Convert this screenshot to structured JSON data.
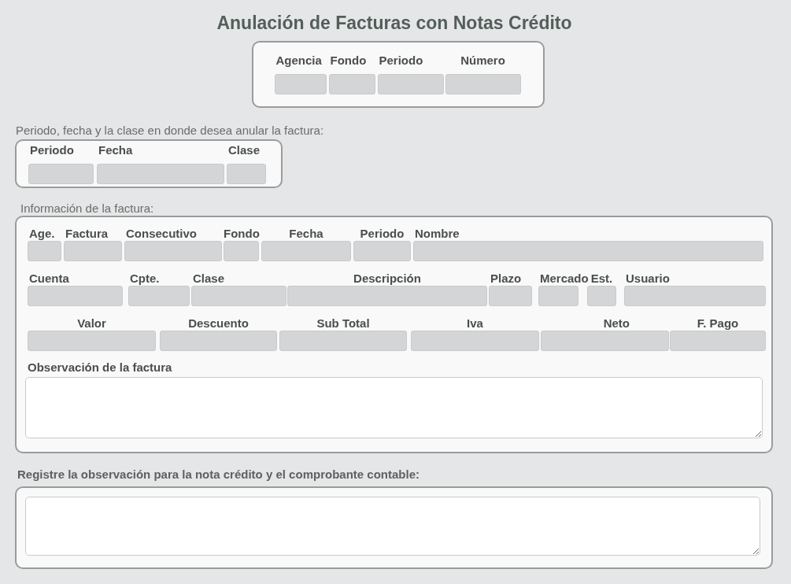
{
  "title": "Anulación de Facturas con Notas Crédito",
  "search": {
    "fields": [
      {
        "label": "Agencia"
      },
      {
        "label": "Fondo"
      },
      {
        "label": "Periodo"
      },
      {
        "label": "Número"
      }
    ]
  },
  "target": {
    "caption": "Periodo, fecha y la clase en donde desea anular la factura:",
    "fields": [
      {
        "label": "Periodo"
      },
      {
        "label": "Fecha"
      },
      {
        "label": "Clase"
      }
    ]
  },
  "invoice": {
    "caption": "Información de la factura:",
    "rows": [
      [
        {
          "label": "Age."
        },
        {
          "label": "Factura"
        },
        {
          "label": "Consecutivo"
        },
        {
          "label": "Fondo"
        },
        {
          "label": "Fecha"
        },
        {
          "label": "Periodo"
        },
        {
          "label": "Nombre"
        }
      ],
      [
        {
          "label": "Cuenta"
        },
        {
          "label": "Cpte."
        },
        {
          "label": "Clase"
        },
        {
          "label": "Descripción"
        },
        {
          "label": "Plazo"
        },
        {
          "label": "Mercado"
        },
        {
          "label": "Est."
        },
        {
          "label": "Usuario"
        }
      ],
      [
        {
          "label": "Valor"
        },
        {
          "label": "Descuento"
        },
        {
          "label": "Sub Total"
        },
        {
          "label": "Iva"
        },
        {
          "label": "Neto"
        },
        {
          "label": "F. Pago"
        }
      ]
    ],
    "observation_label": "Observación de la factura"
  },
  "credit_note": {
    "caption": "Registre la observación para la nota crédito y el comprobante contable:"
  }
}
